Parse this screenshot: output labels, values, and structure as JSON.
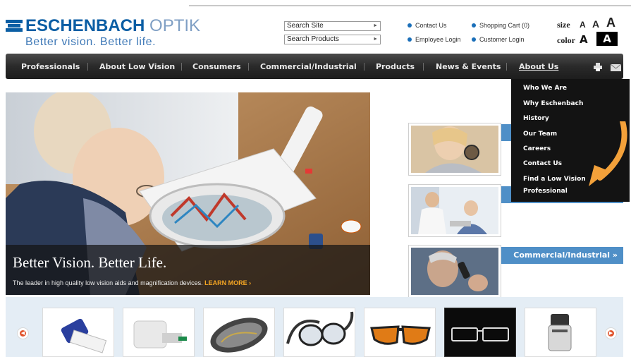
{
  "brand": {
    "name_bold": "ESCHENBACH",
    "name_light": " OPTIK",
    "tagline": "Better vision. Better life."
  },
  "search": {
    "site_label": "Search Site",
    "products_label": "Search Products"
  },
  "top_links": {
    "contact": "Contact Us",
    "cart": "Shopping Cart (0)",
    "employee": "Employee Login",
    "customer": "Customer Login"
  },
  "accessibility": {
    "size_label": "size",
    "color_label": "color",
    "size_letter": "A"
  },
  "nav": [
    "Professionals",
    "About Low Vision",
    "Consumers",
    "Commercial/Industrial",
    "Products",
    "News & Events",
    "About Us"
  ],
  "dropdown": [
    "Who We Are",
    "Why Eschenbach",
    "History",
    "Our Team",
    "Careers",
    "Contact Us",
    "Find a Low Vision",
    "Professional"
  ],
  "hero": {
    "title": "Better Vision. Better Life.",
    "subtitle": "The leader in high quality low vision aids and magnification devices.",
    "learn_more": "LEARN MORE ›"
  },
  "side_tabs": {
    "commercial": "Commercial/Industrial »"
  },
  "colors": {
    "brand_blue": "#0b5ea4",
    "tab_blue": "#4f8fc7",
    "nav_dark": "#2a2a2a",
    "accent_orange": "#f5a623"
  }
}
